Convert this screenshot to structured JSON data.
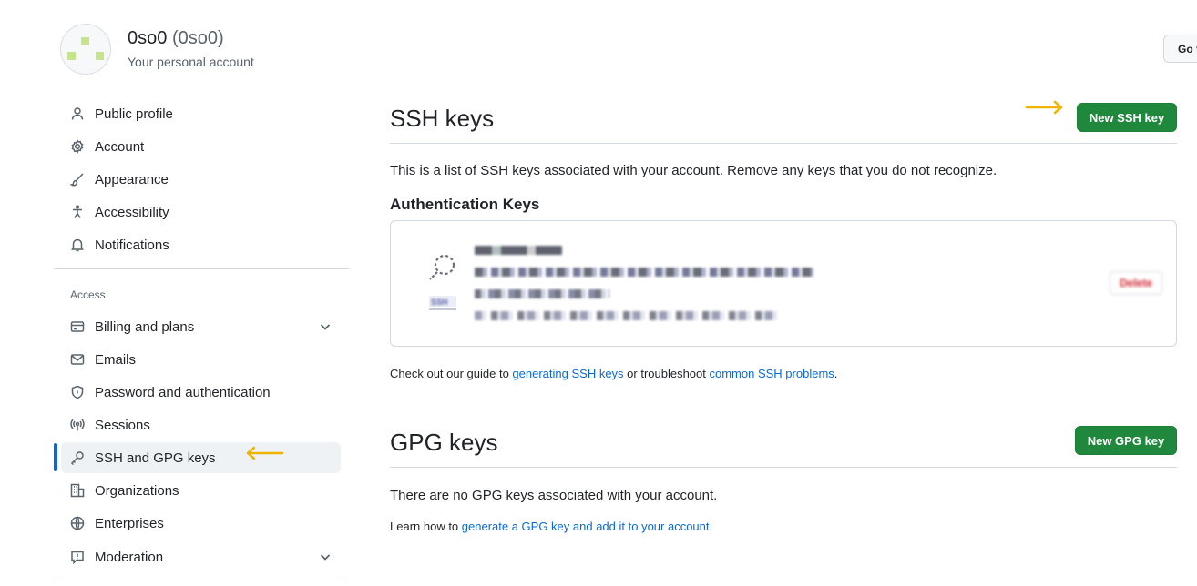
{
  "header": {
    "display_name": "0so0",
    "login": "(0so0)",
    "subtitle": "Your personal account",
    "goto_button": "Go t"
  },
  "sidebar": {
    "items_top": [
      {
        "label": "Public profile",
        "icon": "person-icon"
      },
      {
        "label": "Account",
        "icon": "gear-icon"
      },
      {
        "label": "Appearance",
        "icon": "paintbrush-icon"
      },
      {
        "label": "Accessibility",
        "icon": "accessibility-icon"
      },
      {
        "label": "Notifications",
        "icon": "bell-icon"
      }
    ],
    "access_heading": "Access",
    "items_access": [
      {
        "label": "Billing and plans",
        "icon": "credit-card-icon",
        "expandable": true
      },
      {
        "label": "Emails",
        "icon": "mail-icon"
      },
      {
        "label": "Password and authentication",
        "icon": "shield-lock-icon"
      },
      {
        "label": "Sessions",
        "icon": "broadcast-icon"
      },
      {
        "label": "SSH and GPG keys",
        "icon": "key-icon",
        "active": true
      },
      {
        "label": "Organizations",
        "icon": "organization-icon"
      },
      {
        "label": "Enterprises",
        "icon": "globe-icon"
      },
      {
        "label": "Moderation",
        "icon": "report-icon",
        "expandable": true
      }
    ]
  },
  "ssh": {
    "title": "SSH keys",
    "new_button": "New SSH key",
    "description": "This is a list of SSH keys associated with your account. Remove any keys that you do not recognize.",
    "auth_heading": "Authentication Keys",
    "key": {
      "badge": "SSH",
      "delete_label": "Delete"
    },
    "guide_prefix": "Check out our guide to ",
    "guide_link1": "generating SSH keys",
    "guide_middle": " or troubleshoot ",
    "guide_link2": "common SSH problems",
    "guide_suffix": "."
  },
  "gpg": {
    "title": "GPG keys",
    "new_button": "New GPG key",
    "empty_text": "There are no GPG keys associated with your account.",
    "learn_prefix": "Learn how to ",
    "learn_link": "generate a GPG key and add it to your account",
    "learn_suffix": "."
  },
  "colors": {
    "accent": "#0969da",
    "primary_button": "#1f883d",
    "annotation_arrow": "#f0b400",
    "danger": "#cf222e"
  }
}
